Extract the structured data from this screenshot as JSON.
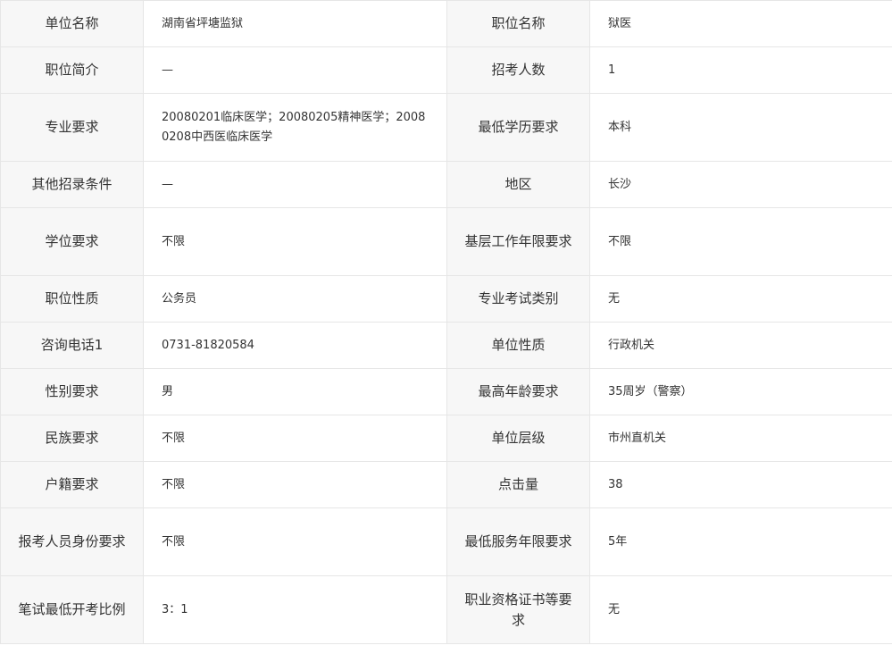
{
  "rows": [
    {
      "l1": "单位名称",
      "v1": "湖南省坪塘监狱",
      "l2": "职位名称",
      "v2": "狱医"
    },
    {
      "l1": "职位简介",
      "v1": "—",
      "l2": "招考人数",
      "v2": "1"
    },
    {
      "l1": "专业要求",
      "v1": "20080201临床医学；20080205精神医学；20080208中西医临床医学",
      "l2": "最低学历要求",
      "v2": "本科"
    },
    {
      "l1": "其他招录条件",
      "v1": "—",
      "l2": "地区",
      "v2": "长沙"
    },
    {
      "l1": "学位要求",
      "v1": "不限",
      "l2": "基层工作年限要求",
      "v2": "不限"
    },
    {
      "l1": "职位性质",
      "v1": "公务员",
      "l2": "专业考试类别",
      "v2": "无"
    },
    {
      "l1": "咨询电话1",
      "v1": "0731-81820584",
      "l2": "单位性质",
      "v2": "行政机关"
    },
    {
      "l1": "性别要求",
      "v1": "男",
      "l2": "最高年龄要求",
      "v2": "35周岁（警察）"
    },
    {
      "l1": "民族要求",
      "v1": "不限",
      "l2": "单位层级",
      "v2": "市州直机关"
    },
    {
      "l1": "户籍要求",
      "v1": "不限",
      "l2": "点击量",
      "v2": "38"
    },
    {
      "l1": "报考人员身份要求",
      "v1": "不限",
      "l2": "最低服务年限要求",
      "v2": "5年"
    },
    {
      "l1": "笔试最低开考比例",
      "v1": "3：1",
      "l2": "职业资格证书等要求",
      "v2": "无"
    }
  ]
}
